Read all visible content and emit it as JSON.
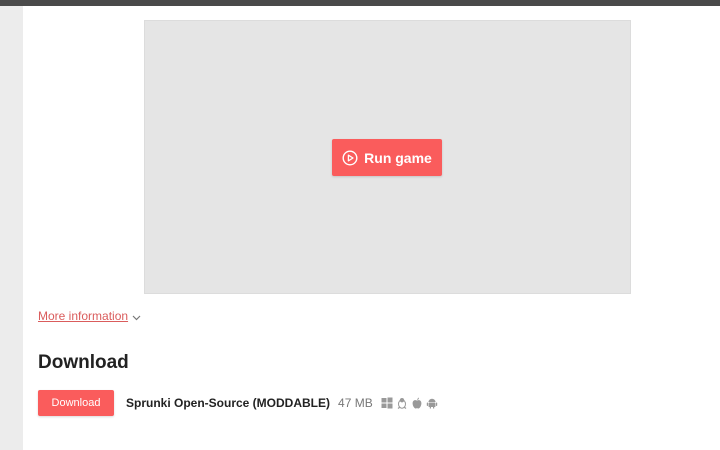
{
  "player": {
    "run_label": "Run game"
  },
  "info": {
    "more_info_label": "More information"
  },
  "download_section": {
    "title": "Download",
    "button_label": "Download",
    "file_name": "Sprunki Open-Source (MODDABLE)",
    "file_size": "47 MB",
    "platform_icons": [
      "windows-icon",
      "linux-icon",
      "apple-icon",
      "android-icon"
    ]
  },
  "colors": {
    "accent": "#fa5c5c",
    "link": "#da5c5c",
    "topbar": "#4a4a4a",
    "embed_bg": "#e5e5e5"
  }
}
